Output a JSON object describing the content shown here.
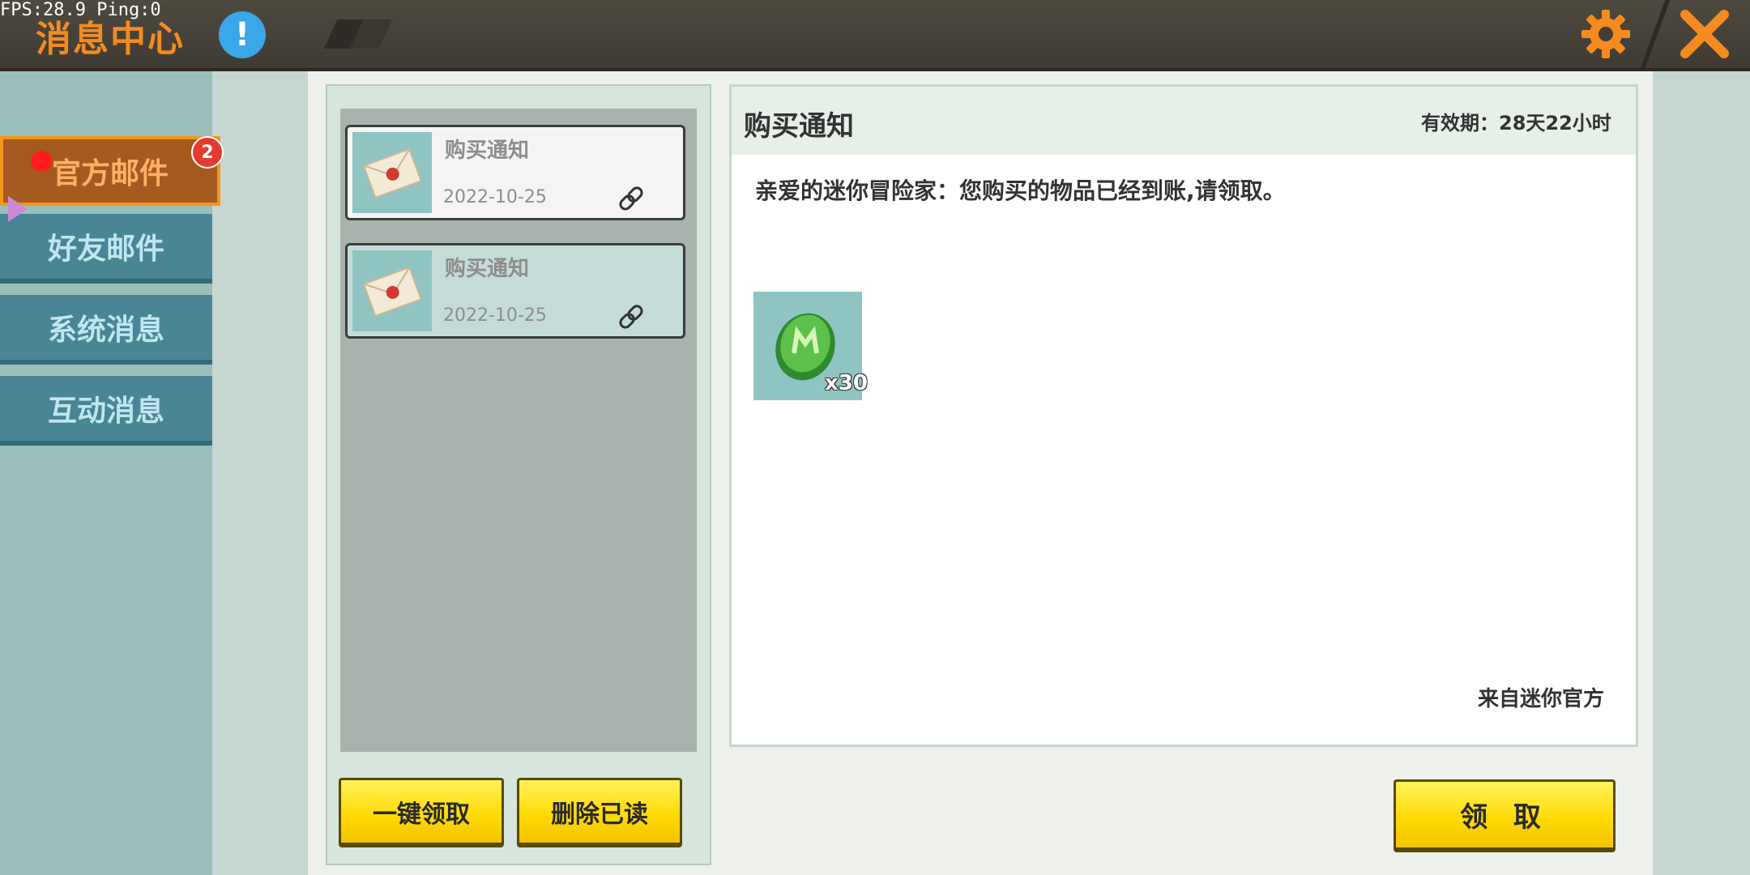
{
  "hud": {
    "fps": "FPS:28.9  Ping:0"
  },
  "header": {
    "title": "消息中心",
    "help_icon": "!",
    "close_icon": "close-icon",
    "settings_icon": "gear-icon"
  },
  "sidebar": {
    "tabs": [
      {
        "label": "官方邮件",
        "active": true,
        "badge": "2"
      },
      {
        "label": "好友邮件",
        "active": false
      },
      {
        "label": "系统消息",
        "active": false
      },
      {
        "label": "互动消息",
        "active": false
      }
    ]
  },
  "mail_list": {
    "items": [
      {
        "title": "购买通知",
        "date": "2022-10-25",
        "selected": false
      },
      {
        "title": "购买通知",
        "date": "2022-10-25",
        "selected": true
      }
    ],
    "claim_all_label": "一键领取",
    "delete_read_label": "删除已读"
  },
  "detail": {
    "title": "购买通知",
    "validity": "有效期：28天22小时",
    "body": "亲爱的迷你冒险家：您购买的物品已经到账,请领取。",
    "reward": {
      "icon": "green-gem-icon",
      "quantity": "x30"
    },
    "sender": "来自迷你官方",
    "claim_label": "领 取"
  },
  "colors": {
    "accent": "#f58b1f",
    "button_yellow": "#ffd800",
    "tab_blue": "#4a8596"
  }
}
